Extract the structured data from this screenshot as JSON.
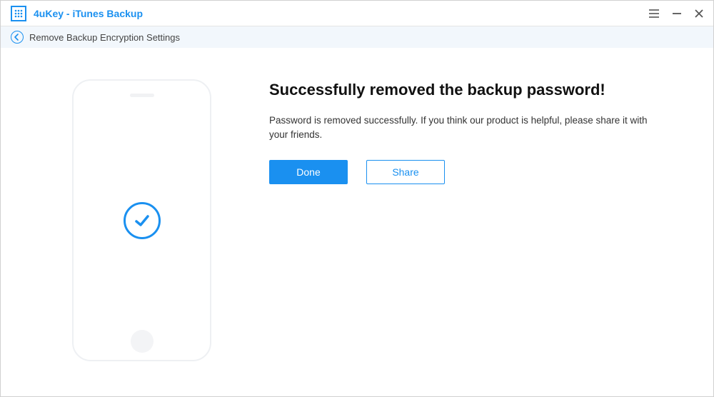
{
  "header": {
    "app_title": "4uKey - iTunes Backup"
  },
  "breadcrumb": {
    "label": "Remove Backup Encryption Settings"
  },
  "main": {
    "heading": "Successfully removed the backup password!",
    "description": "Password is removed successfully. If you think our product is helpful, please share it with your friends.",
    "done_label": "Done",
    "share_label": "Share"
  },
  "colors": {
    "accent": "#1a90f0"
  }
}
